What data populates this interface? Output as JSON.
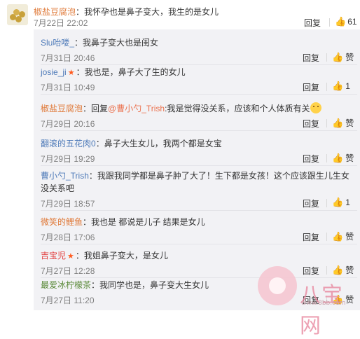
{
  "main_comment": {
    "user": "椒盐豆腐泡",
    "text": "：我怀孕也是鼻子变大，我生的是女儿",
    "date": "7月22日 22:02",
    "reply_label": "回复",
    "like_count": "61"
  },
  "replies": [
    {
      "user": "Slu咍喽_",
      "user_color": "blue",
      "text": "：我鼻子变大也是闺女",
      "date": "7月31日 20:46",
      "reply_label": "回复",
      "like_label": "赞"
    },
    {
      "user": "josie_ji",
      "user_color": "blue",
      "star": true,
      "text": "：我也是，鼻子大了生的女儿",
      "date": "7月31日 10:49",
      "reply_label": "回复",
      "like_label": "1"
    },
    {
      "user": "椒盐豆腐泡",
      "user_color": "orange",
      "prefix": "：回复",
      "mention": "@曹小勺_Trish",
      "text": ":我是觉得没关系，应该和个人体质有关",
      "emoji": true,
      "date": "7月29日 20:16",
      "reply_label": "回复",
      "like_label": "赞"
    },
    {
      "user": "翻滚的五花肉0",
      "user_color": "blue",
      "text": "：鼻子大生女儿，我两个都是女宝",
      "date": "7月29日 19:29",
      "reply_label": "回复",
      "like_label": "赞"
    },
    {
      "user": "曹小勺_Trish",
      "user_color": "blue",
      "text": "：我跟我同学都是鼻子肿了大了！生下都是女孩！这个应该跟生儿生女",
      "text2": "没关系吧",
      "date": "7月29日 18:57",
      "reply_label": "回复",
      "like_label": "1"
    },
    {
      "user": "微笑的鲤鱼",
      "user_color": "orange",
      "text": "：我也是 都说是儿子 结果是女儿",
      "date": "7月28日 17:06",
      "reply_label": "回复",
      "like_label": "赞"
    },
    {
      "user": "吉宝児",
      "user_color": "red",
      "star": true,
      "text": "：我姐鼻子变大，是女儿",
      "date": "7月27日 12:28",
      "reply_label": "回复",
      "like_label": "赞"
    },
    {
      "user": "最爱冰柠檬茶",
      "user_color": "green",
      "text": "：我同学也是，鼻子变大生女儿",
      "date": "7月27日 11:20",
      "reply_label": "回复",
      "like_label": "赞"
    }
  ],
  "watermark": {
    "text": "八宝网",
    "url": "www.8bb.com"
  }
}
